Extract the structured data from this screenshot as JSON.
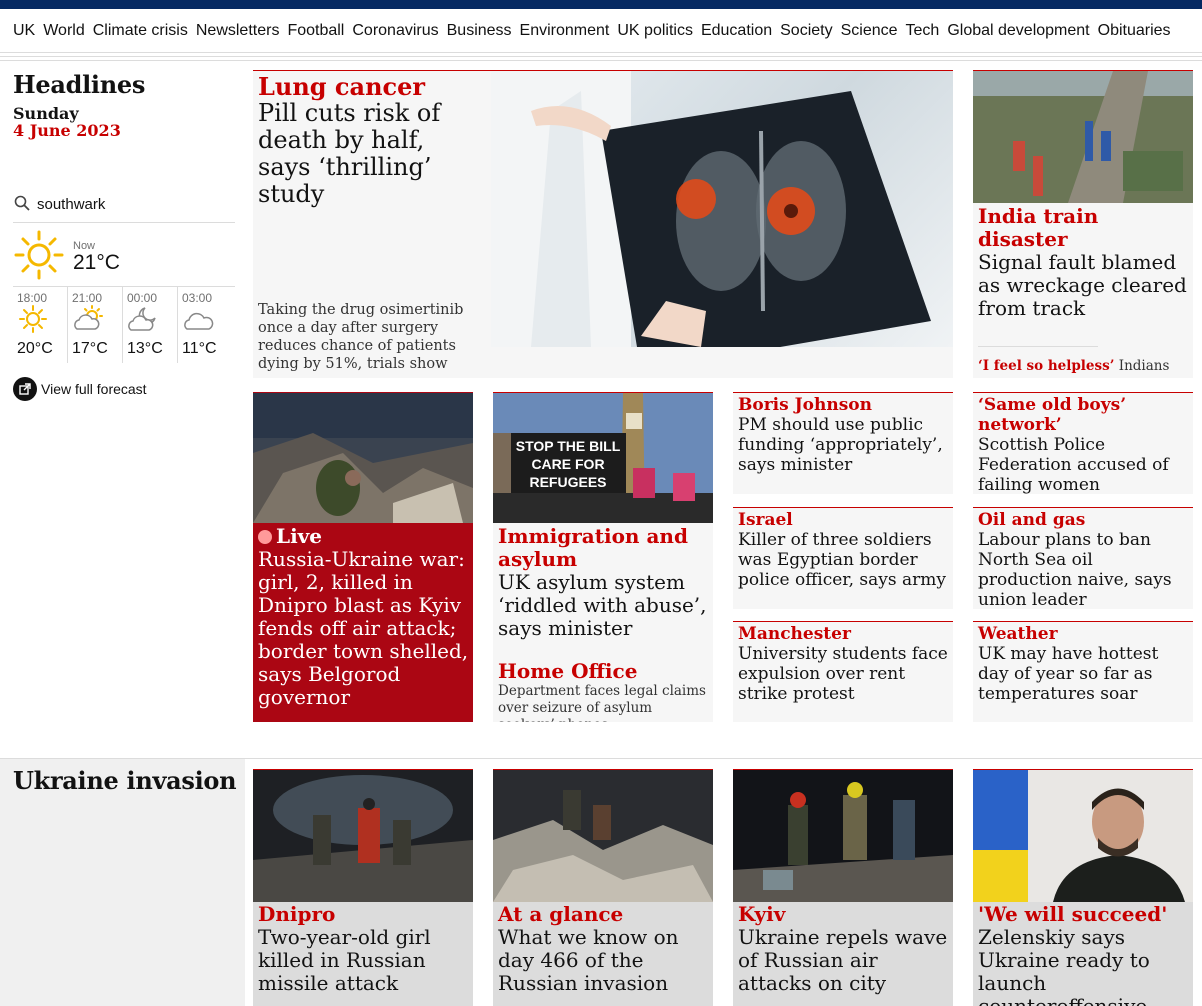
{
  "nav": {
    "items": [
      "UK",
      "World",
      "Climate crisis",
      "Newsletters",
      "Football",
      "Coronavirus",
      "Business",
      "Environment",
      "UK politics",
      "Education",
      "Society",
      "Science",
      "Tech",
      "Global development",
      "Obituaries"
    ]
  },
  "sidebar": {
    "title": "Headlines",
    "day": "Sunday",
    "date": "4 June 2023",
    "search_location": "southwark",
    "now_label": "Now",
    "now_temp": "21°C",
    "forecast": [
      {
        "time": "18:00",
        "temp": "20°C",
        "icon": "sun-icon"
      },
      {
        "time": "21:00",
        "temp": "17°C",
        "icon": "sun-cloud-icon"
      },
      {
        "time": "00:00",
        "temp": "13°C",
        "icon": "moon-cloud-icon"
      },
      {
        "time": "03:00",
        "temp": "11°C",
        "icon": "cloud-icon"
      }
    ],
    "full_forecast": "View full forecast"
  },
  "lead": {
    "kicker": "Lung cancer",
    "headline": "Pill cuts risk of death by half, says ‘thrilling’ study",
    "standfirst": "Taking the drug osimertinib once a day after surgery reduces chance of patients dying by 51%, trials show"
  },
  "side": {
    "kicker": "India train disaster",
    "headline": "Signal fault blamed as wreckage cleared from track",
    "sub_kicker": "‘I feel so helpless’",
    "sub_text": "Indians search for missing family at train crash site"
  },
  "live": {
    "kicker": "Live",
    "headline": "Russia-Ukraine war: girl, 2, killed in Dnipro blast as Kyiv fends off air attack; border town shelled, says Belgorod governor"
  },
  "immigration": {
    "kicker": "Immigration and asylum",
    "headline": "UK asylum system ‘riddled with abuse’, says minister",
    "sub_kicker": "Home Office",
    "sub_text": "Department faces legal claims over seizure of asylum seekers’ phones",
    "placard": [
      "STOP THE BILL",
      "CARE FOR",
      "REFUGEES"
    ]
  },
  "smalls": [
    {
      "kicker": "Boris Johnson",
      "headline": "PM should use public funding ‘appropriately’, says minister"
    },
    {
      "kicker": "Israel",
      "headline": "Killer of three soldiers was Egyptian border police officer, says army"
    },
    {
      "kicker": "Manchester",
      "headline": "University students face expulsion over rent strike protest"
    },
    {
      "kicker": "‘Same old boys’ network’",
      "headline": "Scottish Police Federation accused of failing women"
    },
    {
      "kicker": "Oil and gas",
      "headline": "Labour plans to ban North Sea oil production naive, says union leader"
    },
    {
      "kicker": "Weather",
      "headline": "UK may have hottest day of year so far as temperatures soar"
    }
  ],
  "ukraine": {
    "section_title": "Ukraine invasion",
    "cards": [
      {
        "kicker": "Dnipro",
        "headline": "Two-year-old girl killed in Russian missile attack"
      },
      {
        "kicker": "At a glance",
        "headline": "What we know on day 466 of the Russian invasion"
      },
      {
        "kicker": "Kyiv",
        "headline": "Ukraine repels wave of Russian air attacks on city"
      },
      {
        "kicker": "'We will succeed'",
        "headline": "Zelenskiy says Ukraine ready to launch counteroffensive"
      }
    ]
  },
  "colors": {
    "brand_blue": "#052962",
    "news_red": "#c70000",
    "live_red": "#ab0613"
  }
}
